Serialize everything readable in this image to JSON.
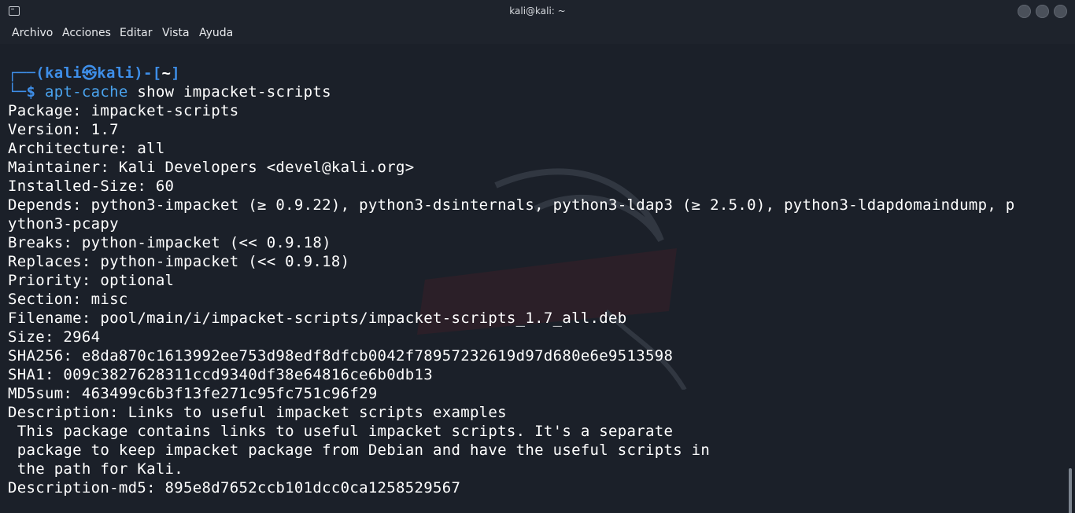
{
  "window": {
    "title": "kali@kali: ~"
  },
  "menu": [
    "Archivo",
    "Acciones",
    "Editar",
    "Vista",
    "Ayuda"
  ],
  "prompt": {
    "open": "┌──(",
    "user": "kali",
    "at": "㉿",
    "host": "kali",
    "mid": ")-[",
    "dir": "~",
    "close": "]",
    "second": "└─$ ",
    "command": "apt-cache",
    "args": " show impacket-scripts"
  },
  "output": [
    "Package: impacket-scripts",
    "Version: 1.7",
    "Architecture: all",
    "Maintainer: Kali Developers <devel@kali.org>",
    "Installed-Size: 60",
    "Depends: python3-impacket (≥ 0.9.22), python3-dsinternals, python3-ldap3 (≥ 2.5.0), python3-ldapdomaindump, p",
    "ython3-pcapy",
    "Breaks: python-impacket (<< 0.9.18)",
    "Replaces: python-impacket (<< 0.9.18)",
    "Priority: optional",
    "Section: misc",
    "Filename: pool/main/i/impacket-scripts/impacket-scripts_1.7_all.deb",
    "Size: 2964",
    "SHA256: e8da870c1613992ee753d98edf8dfcb0042f78957232619d97d680e6e9513598",
    "SHA1: 009c3827628311ccd9340df38e64816ce6b0db13",
    "MD5sum: 463499c6b3f13fe271c95fc751c96f29",
    "Description: Links to useful impacket scripts examples",
    " This package contains links to useful impacket scripts. It's a separate",
    " package to keep impacket package from Debian and have the useful scripts in",
    " the path for Kali.",
    "Description-md5: 895e8d7652ccb101dcc0ca1258529567"
  ],
  "colors": {
    "accent": "#3e8ee8",
    "background": "#1b2029",
    "text": "#ffffff"
  },
  "icons": [
    "terminal-icon",
    "minimize-button",
    "maximize-button",
    "close-button"
  ]
}
